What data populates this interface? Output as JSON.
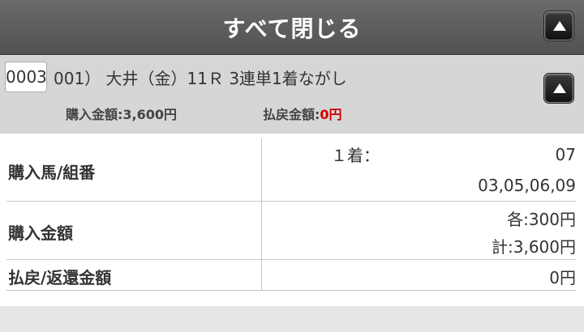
{
  "header": {
    "title": "すべて閉じる",
    "collapse_icon": "triangle-up-icon"
  },
  "ticket": {
    "number": "0003",
    "race_info": "001） 大井（金）11Ｒ 3連単1着ながし",
    "collapse_icon": "triangle-up-icon",
    "purchase_label": "購入金額:",
    "purchase_value": "3,600円",
    "payout_label": "払戻金額:",
    "payout_value": "0円"
  },
  "details": {
    "horses_label": "購入馬/組番",
    "first_label": "１着：",
    "first_value": "07",
    "others_value": "03,05,06,09",
    "amount_label": "購入金額",
    "amount_each": "各:300円",
    "amount_total": "計:3,600円",
    "refund_label": "払戻/返還金額",
    "refund_value": "0円"
  },
  "colors": {
    "header_bg": "#5e5e5e",
    "accent_red": "#cc0000",
    "subhead_bg": "#d6d6d6"
  }
}
